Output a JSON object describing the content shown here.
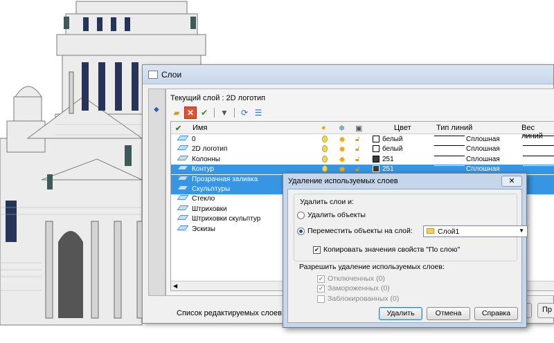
{
  "window": {
    "title": "Слои",
    "current_layer_label": "Текущий слой : 2D логотип",
    "status_text": "Список редактируемых слоев",
    "bottom_buttons": [
      "",
      "Пр"
    ]
  },
  "columns": {
    "status": "",
    "name": "Имя",
    "color": "Цвет",
    "linetype": "Тип линий",
    "lineweight": "Вес линий"
  },
  "layers": [
    {
      "name": "0",
      "color_name": "белый",
      "color_hex": "#ffffff",
      "linetype": "Сплошная",
      "selected": false
    },
    {
      "name": "2D логотип",
      "color_name": "белый",
      "color_hex": "#ffffff",
      "linetype": "Сплошная",
      "selected": false
    },
    {
      "name": "Колонны",
      "color_name": "251",
      "color_hex": "#3a3a3a",
      "linetype": "Сплошная",
      "selected": false
    },
    {
      "name": "Контур",
      "color_name": "251",
      "color_hex": "#3a3a3a",
      "linetype": "Сплошная",
      "selected": true
    },
    {
      "name": "Прозрачная заливка",
      "color_name": "",
      "color_hex": "",
      "linetype": "",
      "selected": true
    },
    {
      "name": "Скульптуры",
      "color_name": "",
      "color_hex": "",
      "linetype": "",
      "selected": true
    },
    {
      "name": "Стекло",
      "color_name": "",
      "color_hex": "",
      "linetype": "",
      "selected": false
    },
    {
      "name": "Штриховки",
      "color_name": "",
      "color_hex": "",
      "linetype": "",
      "selected": false
    },
    {
      "name": "Штриховки скульптур",
      "color_name": "",
      "color_hex": "",
      "linetype": "",
      "selected": false
    },
    {
      "name": "Эскизы",
      "color_name": "",
      "color_hex": "",
      "linetype": "",
      "selected": false
    }
  ],
  "dialog": {
    "title": "Удаление используемых слоев",
    "close": "✕",
    "delete_group_label": "Удалить слои и:",
    "option_delete_objects": "Удалить объекты",
    "option_move_objects": "Переместить объекты на слой:",
    "target_layer": "Слой1",
    "copy_properties": "Копировать значения свойств \"По слою\"",
    "allow_group_label": "Разрешить удаление используемых слоев:",
    "off_layers": "Отключенных (0)",
    "frozen_layers": "Замороженных (0)",
    "locked_layers": "Заблокированных (0)",
    "btn_delete": "Удалить",
    "btn_cancel": "Отмена",
    "btn_help": "Справка"
  },
  "colors": {
    "accent": "#3796e3",
    "dialog_frame": "#c5d6ea"
  }
}
